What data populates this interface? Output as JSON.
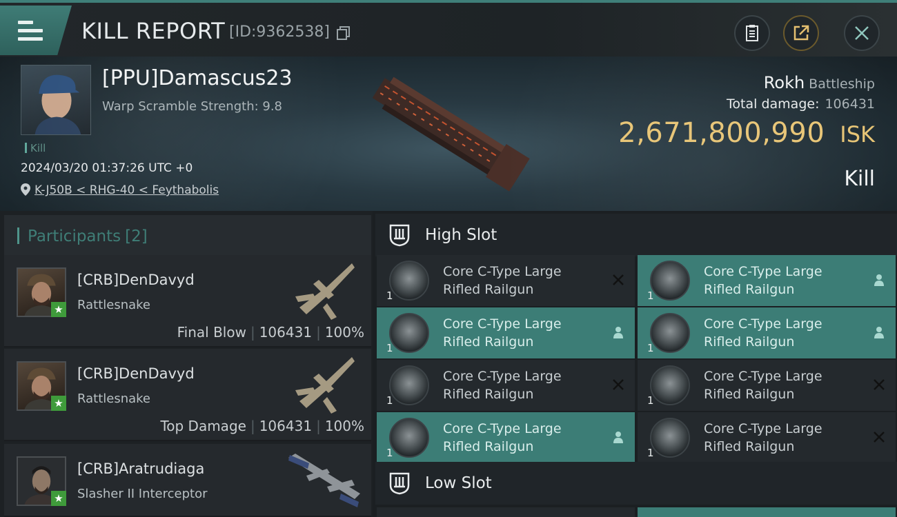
{
  "topbar": {
    "menu_icon": "hamburger-icon",
    "title": "KILL REPORT",
    "report_id": "[ID:9362538]",
    "copy_icon": "copy-icon",
    "clipboard_icon": "clipboard-icon",
    "share_icon": "share-icon",
    "close_icon": "close-icon"
  },
  "victim": {
    "name": "[PPU]Damascus23",
    "warp_scramble": "Warp Scramble Strength: 9.8",
    "tag": "Kill",
    "datetime": "2024/03/20 01:37:26 UTC +0",
    "location": "K-J50B < RHG-40 < Feythabolis",
    "ship_name": "Rokh",
    "ship_class": "Battleship",
    "total_damage_label": "Total damage:",
    "total_damage": "106431",
    "isk_value": "2,671,800,990",
    "isk_unit": "ISK",
    "result": "Kill"
  },
  "participants": {
    "header": "Participants",
    "count": "[2]",
    "rows": [
      {
        "name": "[CRB]DenDavyd",
        "ship": "Rattlesnake",
        "role": "Final Blow",
        "damage": "106431",
        "percent": "100%"
      },
      {
        "name": "[CRB]DenDavyd",
        "ship": "Rattlesnake",
        "role": "Top Damage",
        "damage": "106431",
        "percent": "100%"
      },
      {
        "name": "[CRB]Aratrudiaga",
        "ship": "Slasher II Interceptor"
      }
    ]
  },
  "slots": {
    "high_label": "High Slot",
    "low_label": "Low Slot",
    "modules": [
      {
        "line1": "Core C-Type Large",
        "line2": "Rifled Railgun",
        "qty": "1",
        "status": "destroyed"
      },
      {
        "line1": "Core C-Type Large",
        "line2": "Rifled Railgun",
        "qty": "1",
        "status": "dropped"
      },
      {
        "line1": "Core C-Type Large",
        "line2": "Rifled Railgun",
        "qty": "1",
        "status": "dropped"
      },
      {
        "line1": "Core C-Type Large",
        "line2": "Rifled Railgun",
        "qty": "1",
        "status": "dropped"
      },
      {
        "line1": "Core C-Type Large",
        "line2": "Rifled Railgun",
        "qty": "1",
        "status": "destroyed"
      },
      {
        "line1": "Core C-Type Large",
        "line2": "Rifled Railgun",
        "qty": "1",
        "status": "destroyed"
      },
      {
        "line1": "Core C-Type Large",
        "line2": "Rifled Railgun",
        "qty": "1",
        "status": "dropped"
      },
      {
        "line1": "Core C-Type Large",
        "line2": "Rifled Railgun",
        "qty": "1",
        "status": "destroyed"
      }
    ]
  },
  "colors": {
    "accent_teal": "#3c7d76",
    "isk_gold": "#e7c474",
    "badge_green": "#3f9b3b"
  }
}
